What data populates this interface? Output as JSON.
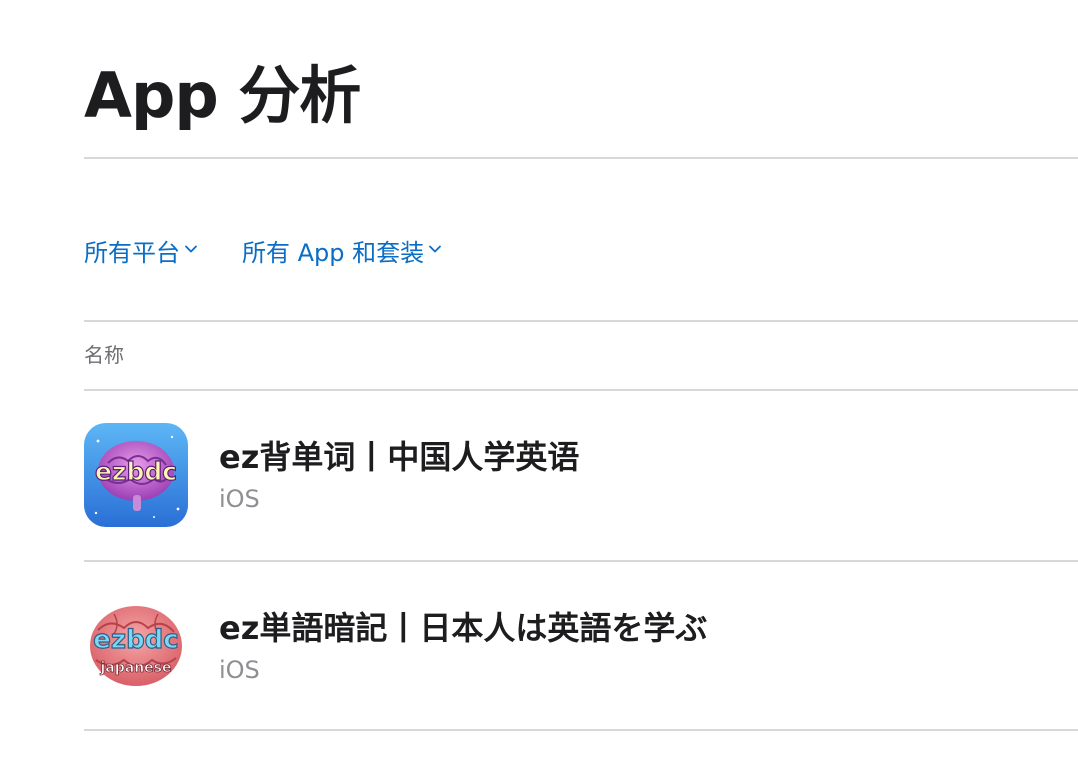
{
  "header": {
    "title": "App 分析"
  },
  "filters": {
    "platform_label": "所有平台",
    "apps_label": "所有 App 和套装"
  },
  "table": {
    "column_name": "名称",
    "rows": [
      {
        "name": "ez背单词丨中国人学英语",
        "platform": "iOS",
        "icon_text": "ezbdc",
        "icon_bg": "#3a8ee8"
      },
      {
        "name": "ez単語暗記丨日本人は英語を学ぶ",
        "platform": "iOS",
        "icon_text": "ezbdc",
        "icon_subtext": "japanese",
        "icon_bg": "#ffffff"
      }
    ]
  },
  "colors": {
    "link": "#0b6ec5",
    "text": "#1d1d1f",
    "secondary": "#8e8e93",
    "divider": "#d8d8d8"
  }
}
